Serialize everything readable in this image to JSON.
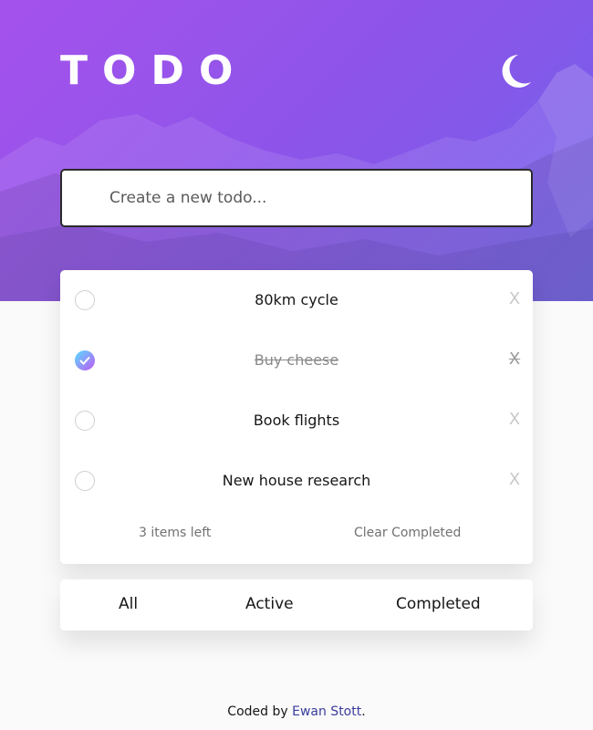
{
  "app": {
    "title": "TODO"
  },
  "theme_toggle": {
    "icon": "moon-icon"
  },
  "create": {
    "placeholder": "Create a new todo..."
  },
  "todos": [
    {
      "text": "80km cycle",
      "completed": false,
      "delete_label": "X"
    },
    {
      "text": "Buy cheese",
      "completed": true,
      "delete_label": "X"
    },
    {
      "text": "Book flights",
      "completed": false,
      "delete_label": "X"
    },
    {
      "text": "New house research",
      "completed": false,
      "delete_label": "X"
    }
  ],
  "list_footer": {
    "items_left": "3 items left",
    "clear_completed": "Clear Completed"
  },
  "filters": {
    "all": "All",
    "active": "Active",
    "completed": "Completed"
  },
  "credit": {
    "prefix": "Coded by ",
    "author": "Ewan Stott",
    "suffix": "."
  },
  "colors": {
    "gradient_start": "#a552ec",
    "gradient_end": "#6f62ea",
    "check_start": "#57ddff",
    "check_end": "#c058f3",
    "link": "#3a3e9c"
  }
}
